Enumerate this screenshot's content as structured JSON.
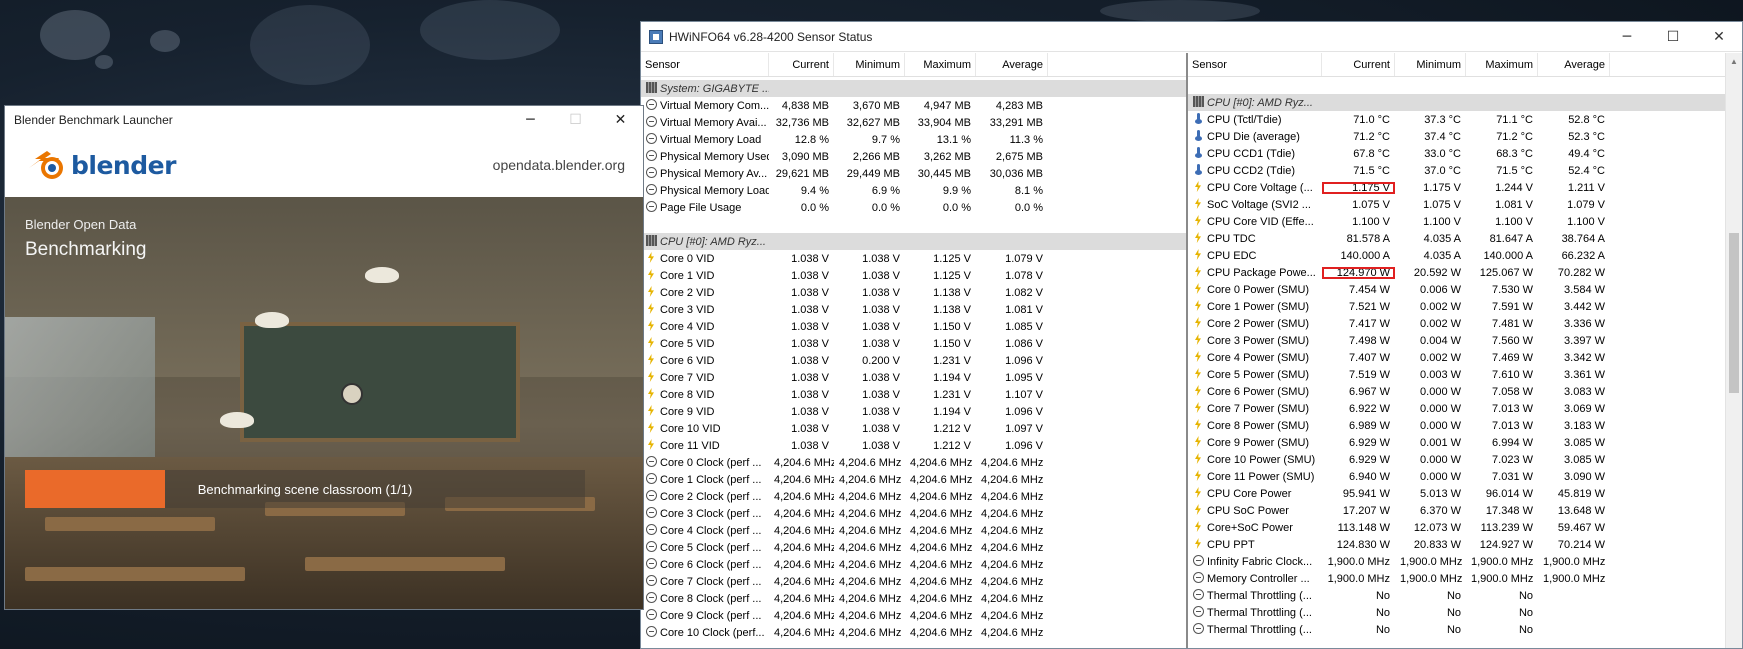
{
  "hwinfo": {
    "title": "HWiNFO64 v6.28-4200 Sensor Status",
    "left_headers": [
      "Sensor",
      "Current",
      "Minimum",
      "Maximum",
      "Average"
    ],
    "right_headers": [
      "Sensor",
      "Current",
      "Minimum",
      "Maximum",
      "Average"
    ],
    "left_rows": [
      {
        "type": "group",
        "icon": "chip-icon",
        "cells": [
          "System: GIGABYTE ...",
          "",
          "",
          "",
          ""
        ]
      },
      {
        "icon": "clock-icon",
        "cells": [
          "Virtual Memory Com...",
          "4,838 MB",
          "3,670 MB",
          "4,947 MB",
          "4,283 MB"
        ]
      },
      {
        "icon": "clock-icon",
        "cells": [
          "Virtual Memory Avai...",
          "32,736 MB",
          "32,627 MB",
          "33,904 MB",
          "33,291 MB"
        ]
      },
      {
        "icon": "clock-icon",
        "cells": [
          "Virtual Memory Load",
          "12.8 %",
          "9.7 %",
          "13.1 %",
          "11.3 %"
        ]
      },
      {
        "icon": "clock-icon",
        "cells": [
          "Physical Memory Used",
          "3,090 MB",
          "2,266 MB",
          "3,262 MB",
          "2,675 MB"
        ]
      },
      {
        "icon": "clock-icon",
        "cells": [
          "Physical Memory Av...",
          "29,621 MB",
          "29,449 MB",
          "30,445 MB",
          "30,036 MB"
        ]
      },
      {
        "icon": "clock-icon",
        "cells": [
          "Physical Memory Load",
          "9.4 %",
          "6.9 %",
          "9.9 %",
          "8.1 %"
        ]
      },
      {
        "icon": "clock-icon",
        "cells": [
          "Page File Usage",
          "0.0 %",
          "0.0 %",
          "0.0 %",
          "0.0 %"
        ]
      },
      {
        "type": "blank",
        "cells": [
          "",
          "",
          "",
          "",
          ""
        ]
      },
      {
        "type": "group",
        "icon": "chip-icon",
        "cells": [
          "CPU [#0]: AMD Ryz...",
          "",
          "",
          "",
          ""
        ]
      },
      {
        "icon": "bolt-icon",
        "cells": [
          "Core 0 VID",
          "1.038 V",
          "1.038 V",
          "1.125 V",
          "1.079 V"
        ]
      },
      {
        "icon": "bolt-icon",
        "cells": [
          "Core 1 VID",
          "1.038 V",
          "1.038 V",
          "1.125 V",
          "1.078 V"
        ]
      },
      {
        "icon": "bolt-icon",
        "cells": [
          "Core 2 VID",
          "1.038 V",
          "1.038 V",
          "1.138 V",
          "1.082 V"
        ]
      },
      {
        "icon": "bolt-icon",
        "cells": [
          "Core 3 VID",
          "1.038 V",
          "1.038 V",
          "1.138 V",
          "1.081 V"
        ]
      },
      {
        "icon": "bolt-icon",
        "cells": [
          "Core 4 VID",
          "1.038 V",
          "1.038 V",
          "1.150 V",
          "1.085 V"
        ]
      },
      {
        "icon": "bolt-icon",
        "cells": [
          "Core 5 VID",
          "1.038 V",
          "1.038 V",
          "1.150 V",
          "1.086 V"
        ]
      },
      {
        "icon": "bolt-icon",
        "cells": [
          "Core 6 VID",
          "1.038 V",
          "0.200 V",
          "1.231 V",
          "1.096 V"
        ]
      },
      {
        "icon": "bolt-icon",
        "cells": [
          "Core 7 VID",
          "1.038 V",
          "1.038 V",
          "1.194 V",
          "1.095 V"
        ]
      },
      {
        "icon": "bolt-icon",
        "cells": [
          "Core 8 VID",
          "1.038 V",
          "1.038 V",
          "1.231 V",
          "1.107 V"
        ]
      },
      {
        "icon": "bolt-icon",
        "cells": [
          "Core 9 VID",
          "1.038 V",
          "1.038 V",
          "1.194 V",
          "1.096 V"
        ]
      },
      {
        "icon": "bolt-icon",
        "cells": [
          "Core 10 VID",
          "1.038 V",
          "1.038 V",
          "1.212 V",
          "1.097 V"
        ]
      },
      {
        "icon": "bolt-icon",
        "cells": [
          "Core 11 VID",
          "1.038 V",
          "1.038 V",
          "1.212 V",
          "1.096 V"
        ]
      },
      {
        "icon": "clock-icon",
        "cells": [
          "Core 0 Clock (perf ...",
          "4,204.6 MHz",
          "4,204.6 MHz",
          "4,204.6 MHz",
          "4,204.6 MHz"
        ]
      },
      {
        "icon": "clock-icon",
        "cells": [
          "Core 1 Clock (perf ...",
          "4,204.6 MHz",
          "4,204.6 MHz",
          "4,204.6 MHz",
          "4,204.6 MHz"
        ]
      },
      {
        "icon": "clock-icon",
        "cells": [
          "Core 2 Clock (perf ...",
          "4,204.6 MHz",
          "4,204.6 MHz",
          "4,204.6 MHz",
          "4,204.6 MHz"
        ]
      },
      {
        "icon": "clock-icon",
        "cells": [
          "Core 3 Clock (perf ...",
          "4,204.6 MHz",
          "4,204.6 MHz",
          "4,204.6 MHz",
          "4,204.6 MHz"
        ]
      },
      {
        "icon": "clock-icon",
        "cells": [
          "Core 4 Clock (perf ...",
          "4,204.6 MHz",
          "4,204.6 MHz",
          "4,204.6 MHz",
          "4,204.6 MHz"
        ]
      },
      {
        "icon": "clock-icon",
        "cells": [
          "Core 5 Clock (perf ...",
          "4,204.6 MHz",
          "4,204.6 MHz",
          "4,204.6 MHz",
          "4,204.6 MHz"
        ]
      },
      {
        "icon": "clock-icon",
        "cells": [
          "Core 6 Clock (perf ...",
          "4,204.6 MHz",
          "4,204.6 MHz",
          "4,204.6 MHz",
          "4,204.6 MHz"
        ]
      },
      {
        "icon": "clock-icon",
        "cells": [
          "Core 7 Clock (perf ...",
          "4,204.6 MHz",
          "4,204.6 MHz",
          "4,204.6 MHz",
          "4,204.6 MHz"
        ]
      },
      {
        "icon": "clock-icon",
        "cells": [
          "Core 8 Clock (perf ...",
          "4,204.6 MHz",
          "4,204.6 MHz",
          "4,204.6 MHz",
          "4,204.6 MHz"
        ]
      },
      {
        "icon": "clock-icon",
        "cells": [
          "Core 9 Clock (perf ...",
          "4,204.6 MHz",
          "4,204.6 MHz",
          "4,204.6 MHz",
          "4,204.6 MHz"
        ]
      },
      {
        "icon": "clock-icon",
        "cells": [
          "Core 10 Clock (perf...",
          "4,204.6 MHz",
          "4,204.6 MHz",
          "4,204.6 MHz",
          "4,204.6 MHz"
        ]
      }
    ],
    "right_rows": [
      {
        "type": "blank",
        "cells": [
          "",
          "",
          "",
          "",
          ""
        ]
      },
      {
        "type": "group",
        "icon": "chip-icon",
        "cells": [
          "CPU [#0]: AMD Ryz...",
          "",
          "",
          "",
          ""
        ]
      },
      {
        "icon": "thermometer-icon",
        "cells": [
          "CPU (Tctl/Tdie)",
          "71.0 °C",
          "37.3 °C",
          "71.1 °C",
          "52.8 °C"
        ]
      },
      {
        "icon": "thermometer-icon",
        "cells": [
          "CPU Die (average)",
          "71.2 °C",
          "37.4 °C",
          "71.2 °C",
          "52.3 °C"
        ]
      },
      {
        "icon": "thermometer-icon",
        "cells": [
          "CPU CCD1 (Tdie)",
          "67.8 °C",
          "33.0 °C",
          "68.3 °C",
          "49.4 °C"
        ]
      },
      {
        "icon": "thermometer-icon",
        "cells": [
          "CPU CCD2 (Tdie)",
          "71.5 °C",
          "37.0 °C",
          "71.5 °C",
          "52.4 °C"
        ]
      },
      {
        "icon": "bolt-icon",
        "highlight": true,
        "cells": [
          "CPU Core Voltage (...",
          "1.175 V",
          "1.175 V",
          "1.244 V",
          "1.211 V"
        ]
      },
      {
        "icon": "bolt-icon",
        "cells": [
          "SoC Voltage (SVI2 ...",
          "1.075 V",
          "1.075 V",
          "1.081 V",
          "1.079 V"
        ]
      },
      {
        "icon": "bolt-icon",
        "cells": [
          "CPU Core VID (Effe...",
          "1.100 V",
          "1.100 V",
          "1.100 V",
          "1.100 V"
        ]
      },
      {
        "icon": "bolt-icon",
        "cells": [
          "CPU TDC",
          "81.578 A",
          "4.035 A",
          "81.647 A",
          "38.764 A"
        ]
      },
      {
        "icon": "bolt-icon",
        "cells": [
          "CPU EDC",
          "140.000 A",
          "4.035 A",
          "140.000 A",
          "66.232 A"
        ]
      },
      {
        "icon": "bolt-icon",
        "highlight": true,
        "cells": [
          "CPU Package Powe...",
          "124.970 W",
          "20.592 W",
          "125.067 W",
          "70.282 W"
        ]
      },
      {
        "icon": "bolt-icon",
        "cells": [
          "Core 0 Power (SMU)",
          "7.454 W",
          "0.006 W",
          "7.530 W",
          "3.584 W"
        ]
      },
      {
        "icon": "bolt-icon",
        "cells": [
          "Core 1 Power (SMU)",
          "7.521 W",
          "0.002 W",
          "7.591 W",
          "3.442 W"
        ]
      },
      {
        "icon": "bolt-icon",
        "cells": [
          "Core 2 Power (SMU)",
          "7.417 W",
          "0.002 W",
          "7.481 W",
          "3.336 W"
        ]
      },
      {
        "icon": "bolt-icon",
        "cells": [
          "Core 3 Power (SMU)",
          "7.498 W",
          "0.004 W",
          "7.560 W",
          "3.397 W"
        ]
      },
      {
        "icon": "bolt-icon",
        "cells": [
          "Core 4 Power (SMU)",
          "7.407 W",
          "0.002 W",
          "7.469 W",
          "3.342 W"
        ]
      },
      {
        "icon": "bolt-icon",
        "cells": [
          "Core 5 Power (SMU)",
          "7.519 W",
          "0.003 W",
          "7.610 W",
          "3.361 W"
        ]
      },
      {
        "icon": "bolt-icon",
        "cells": [
          "Core 6 Power (SMU)",
          "6.967 W",
          "0.000 W",
          "7.058 W",
          "3.083 W"
        ]
      },
      {
        "icon": "bolt-icon",
        "cells": [
          "Core 7 Power (SMU)",
          "6.922 W",
          "0.000 W",
          "7.013 W",
          "3.069 W"
        ]
      },
      {
        "icon": "bolt-icon",
        "cells": [
          "Core 8 Power (SMU)",
          "6.989 W",
          "0.000 W",
          "7.013 W",
          "3.183 W"
        ]
      },
      {
        "icon": "bolt-icon",
        "cells": [
          "Core 9 Power (SMU)",
          "6.929 W",
          "0.001 W",
          "6.994 W",
          "3.085 W"
        ]
      },
      {
        "icon": "bolt-icon",
        "cells": [
          "Core 10 Power (SMU)",
          "6.929 W",
          "0.000 W",
          "7.023 W",
          "3.085 W"
        ]
      },
      {
        "icon": "bolt-icon",
        "cells": [
          "Core 11 Power (SMU)",
          "6.940 W",
          "0.000 W",
          "7.031 W",
          "3.090 W"
        ]
      },
      {
        "icon": "bolt-icon",
        "cells": [
          "CPU Core Power",
          "95.941 W",
          "5.013 W",
          "96.014 W",
          "45.819 W"
        ]
      },
      {
        "icon": "bolt-icon",
        "cells": [
          "CPU SoC Power",
          "17.207 W",
          "6.370 W",
          "17.348 W",
          "13.648 W"
        ]
      },
      {
        "icon": "bolt-icon",
        "cells": [
          "Core+SoC Power",
          "113.148 W",
          "12.073 W",
          "113.239 W",
          "59.467 W"
        ]
      },
      {
        "icon": "bolt-icon",
        "cells": [
          "CPU PPT",
          "124.830 W",
          "20.833 W",
          "124.927 W",
          "70.214 W"
        ]
      },
      {
        "icon": "clock-icon",
        "cells": [
          "Infinity Fabric Clock...",
          "1,900.0 MHz",
          "1,900.0 MHz",
          "1,900.0 MHz",
          "1,900.0 MHz"
        ]
      },
      {
        "icon": "clock-icon",
        "cells": [
          "Memory Controller ...",
          "1,900.0 MHz",
          "1,900.0 MHz",
          "1,900.0 MHz",
          "1,900.0 MHz"
        ]
      },
      {
        "icon": "clock-icon",
        "cells": [
          "Thermal Throttling (...",
          "No",
          "No",
          "No",
          ""
        ]
      },
      {
        "icon": "clock-icon",
        "cells": [
          "Thermal Throttling (...",
          "No",
          "No",
          "No",
          ""
        ]
      },
      {
        "icon": "clock-icon",
        "cells": [
          "Thermal Throttling (...",
          "No",
          "No",
          "No",
          ""
        ]
      }
    ]
  },
  "blender": {
    "title": "Blender Benchmark Launcher",
    "logo_text": "blender",
    "url": "opendata.blender.org",
    "label_small": "Blender Open Data",
    "label_big": "Benchmarking",
    "progress_text": "Benchmarking scene classroom (1/1)",
    "progress_fraction": 0.25,
    "accent_color": "#ea6a2a",
    "logo_blue": "#1d5aa0"
  }
}
